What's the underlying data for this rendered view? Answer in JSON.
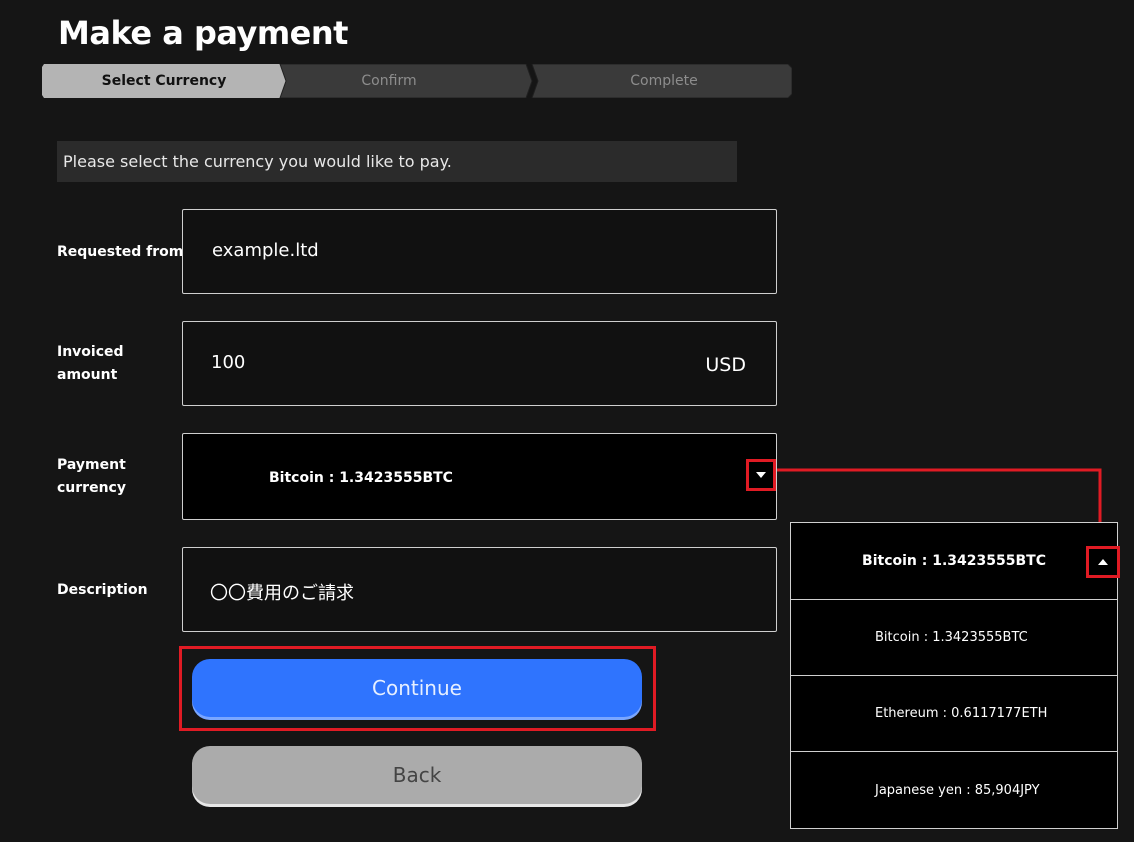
{
  "page": {
    "title": "Make a payment"
  },
  "stepper": {
    "steps": [
      {
        "label": "Select Currency",
        "active": true
      },
      {
        "label": "Confirm",
        "active": false
      },
      {
        "label": "Complete",
        "active": false
      }
    ]
  },
  "instruction": "Please select the currency you would like to pay.",
  "form": {
    "requested_from": {
      "label": "Requested from",
      "value": "example.ltd"
    },
    "invoiced_amount": {
      "label_line1": "Invoiced",
      "label_line2": "amount",
      "value": "100",
      "unit": "USD"
    },
    "payment_currency": {
      "label_line1": "Payment",
      "label_line2": "currency",
      "value": "Bitcoin : 1.3423555BTC"
    },
    "description": {
      "label": "Description",
      "value": "〇〇費用のご請求"
    }
  },
  "buttons": {
    "continue": "Continue",
    "back": "Back"
  },
  "dropdown": {
    "selected": "Bitcoin : 1.3423555BTC",
    "options": [
      "Bitcoin : 1.3423555BTC",
      "Ethereum : 0.6117177ETH",
      "Japanese yen : 85,904JPY"
    ]
  },
  "colors": {
    "background": "#151515",
    "accent_blue": "#2f74fe",
    "highlight_red": "#e01b24",
    "active_step": "#b4b4b4",
    "inactive_step": "#3a3a3a"
  },
  "icons": [
    "dropdown-arrow-down-icon",
    "dropdown-arrow-up-icon",
    "connector-arrow-icon"
  ]
}
